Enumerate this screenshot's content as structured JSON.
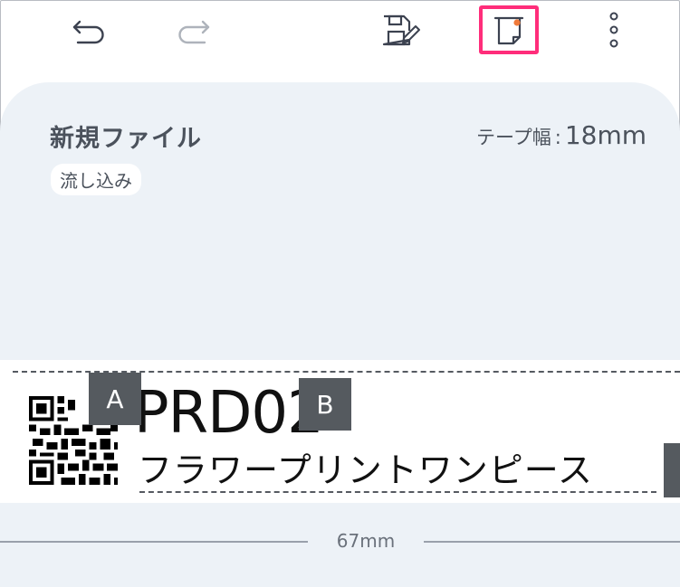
{
  "toolbar": {
    "undo_icon": "undo-icon",
    "redo_icon": "redo-icon",
    "save_icon": "save-edit-icon",
    "print_icon": "print-label-icon",
    "more_icon": "more-vertical-icon",
    "accent_color": "#ff2d7a",
    "print_status_dot_color": "#f07a3a"
  },
  "document": {
    "title": "新規ファイル",
    "tape_width_label": "テープ幅",
    "tape_width_separator": ":",
    "tape_width_value": "18mm",
    "mode": "流し込み"
  },
  "label": {
    "marker_a": "A",
    "marker_b": "B",
    "code_text": "PRD02",
    "product_text": "フラワープリントワンピース",
    "length_value": "67mm"
  },
  "colors": {
    "card_background": "#edf2f7",
    "marker_background": "#555a5f"
  }
}
